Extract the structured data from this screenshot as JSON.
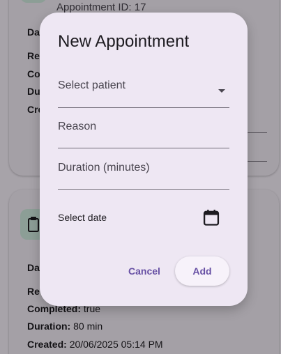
{
  "background": {
    "card1": {
      "appointment_id": "Appointment ID: 17",
      "rows": [
        "Da",
        "Re",
        "Co",
        "Du",
        "Cre"
      ]
    },
    "card2": {
      "rows_partial": [
        "Da",
        "Re"
      ],
      "completed_label": "Completed:",
      "completed_value": "true",
      "duration_label": "Duration:",
      "duration_value": "80 min",
      "created_label": "Created:",
      "created_value": "20/06/2025 05:14 PM"
    }
  },
  "dialog": {
    "title": "New Appointment",
    "patient_label": "Select patient",
    "reason_label": "Reason",
    "duration_label": "Duration (minutes)",
    "date_label": "Select date",
    "cancel_label": "Cancel",
    "add_label": "Add"
  },
  "colors": {
    "primary": "#6750a4",
    "dialog_bg": "#eee7f3",
    "icon_tile": "#cfe9de"
  },
  "icons": {
    "dropdown": "arrow-drop-down-icon",
    "calendar": "calendar-icon"
  }
}
